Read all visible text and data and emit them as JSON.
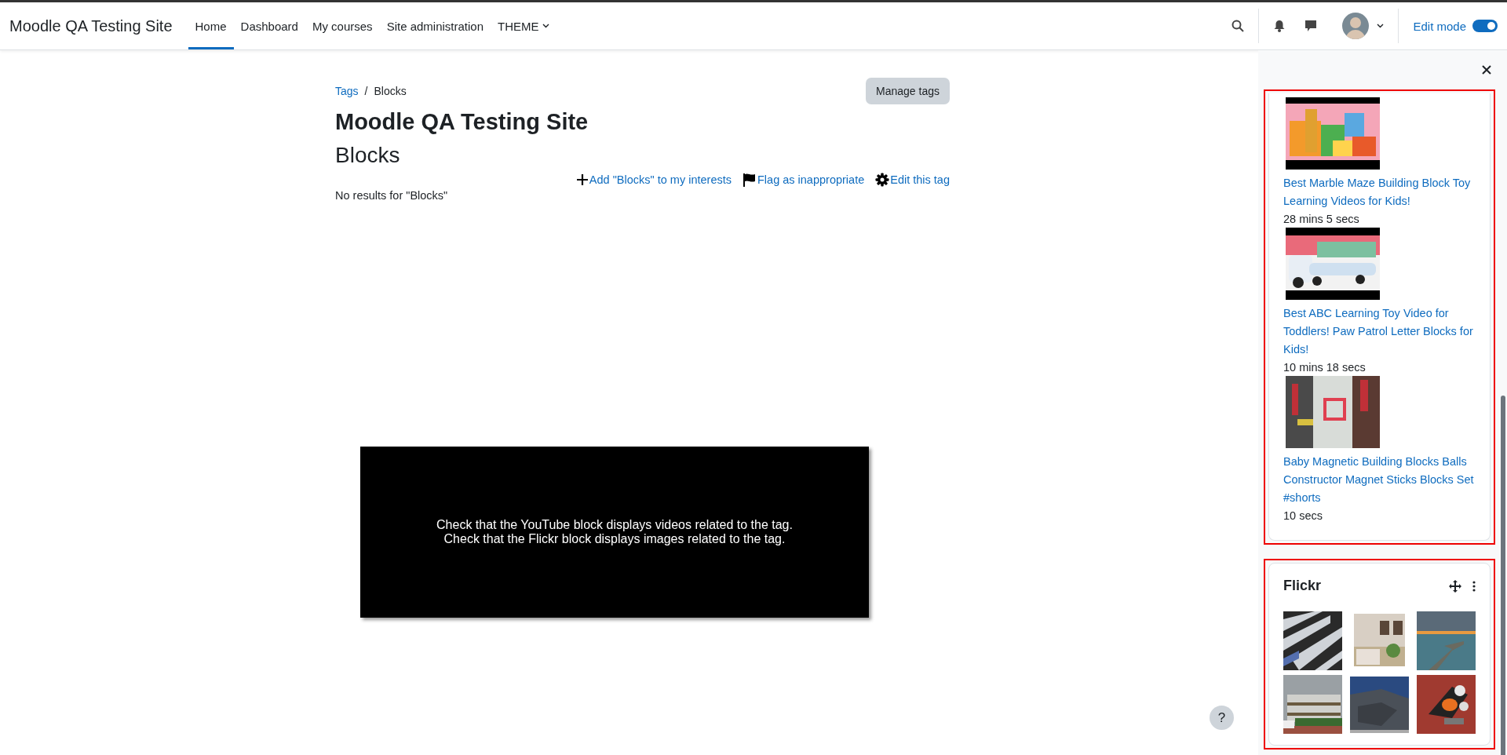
{
  "header": {
    "site_name": "Moodle QA Testing Site",
    "nav": [
      {
        "label": "Home",
        "selected": true
      },
      {
        "label": "Dashboard",
        "selected": false
      },
      {
        "label": "My courses",
        "selected": false
      },
      {
        "label": "Site administration",
        "selected": false
      },
      {
        "label": "THEME",
        "selected": false,
        "kind": "dropdown"
      }
    ],
    "edit_mode": {
      "label": "Edit mode",
      "on": true
    }
  },
  "breadcrumb": {
    "items": [
      "Tags",
      "Blocks"
    ],
    "separator": "/"
  },
  "manage_tags": "Manage tags",
  "page_title": "Moodle QA Testing Site",
  "tag_name": "Blocks",
  "actions": [
    {
      "kind": "add",
      "label": "Add \"Blocks\" to my interests"
    },
    {
      "kind": "flag",
      "label": "Flag as inappropriate"
    },
    {
      "kind": "edit",
      "label": "Edit this tag"
    }
  ],
  "no_results": "No results for \"Blocks\"",
  "instructions": [
    "Check that the YouTube block displays videos related to the tag.",
    "Check that the Flickr block displays images related to the tag."
  ],
  "youtube_videos": [
    {
      "title": "Best Marble Maze Building Block Toy Learning Videos for Kids!",
      "duration": "28 mins 5 secs"
    },
    {
      "title": "Best ABC Learning Toy Video for Toddlers! Paw Patrol Letter Blocks for Kids!",
      "duration": "10 mins 18 secs"
    },
    {
      "title": "Baby Magnetic Building Blocks Balls Constructor Magnet Sticks Blocks Set #shorts",
      "duration": "10 secs"
    }
  ],
  "flickr": {
    "title": "Flickr"
  },
  "help_button": "?"
}
